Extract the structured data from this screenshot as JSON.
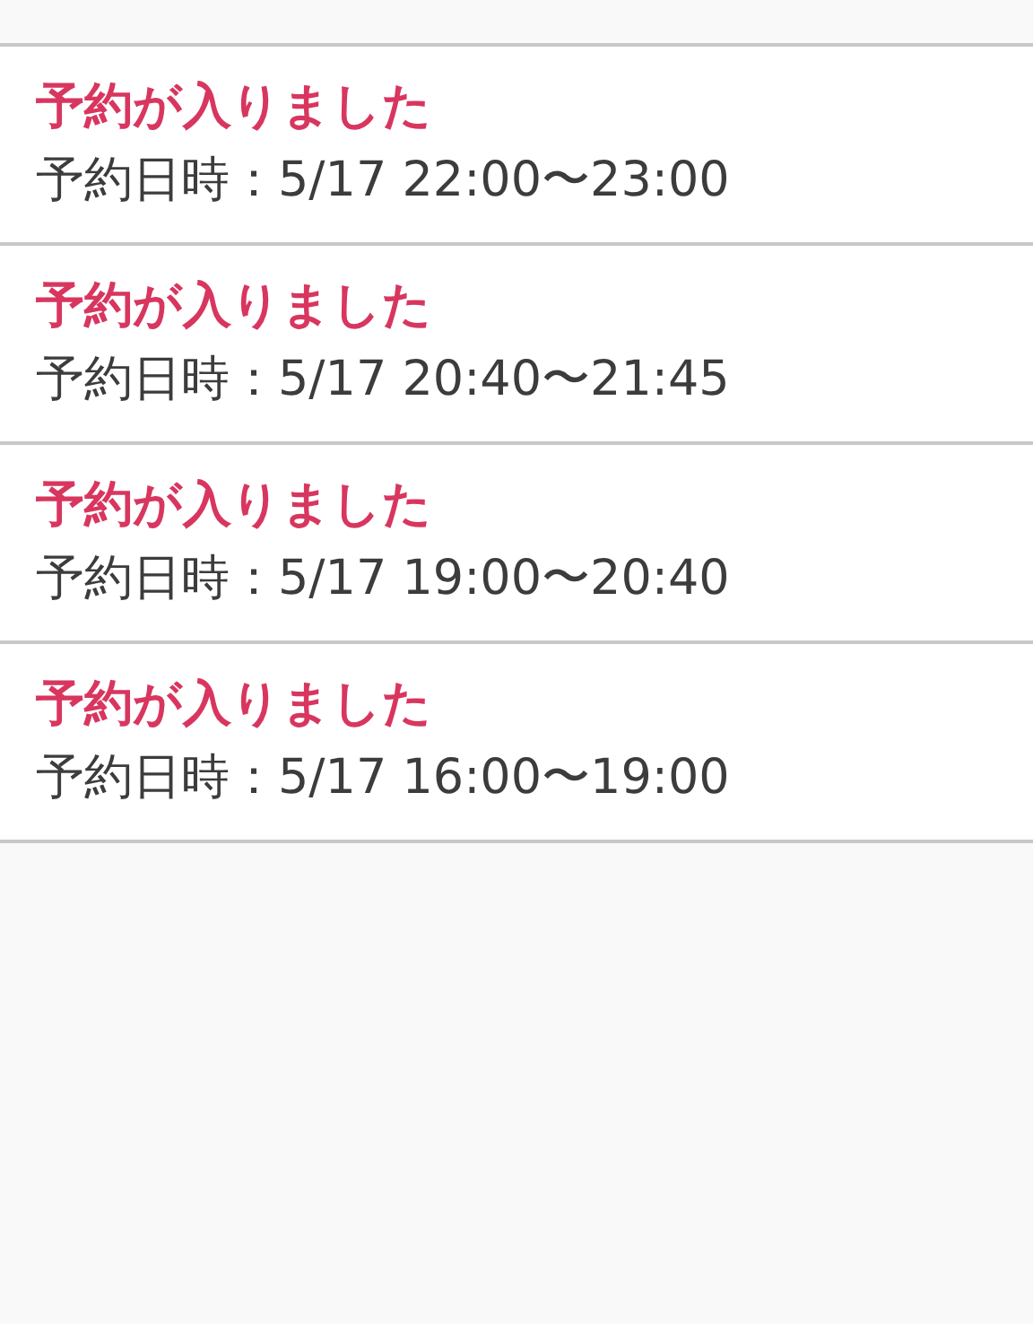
{
  "notifications": [
    {
      "title": "予約が入りました",
      "detail": "予約日時：5/17 22:00〜23:00"
    },
    {
      "title": "予約が入りました",
      "detail": "予約日時：5/17 20:40〜21:45"
    },
    {
      "title": "予約が入りました",
      "detail": "予約日時：5/17 19:00〜20:40"
    },
    {
      "title": "予約が入りました",
      "detail": "予約日時：5/17 16:00〜19:00"
    }
  ]
}
